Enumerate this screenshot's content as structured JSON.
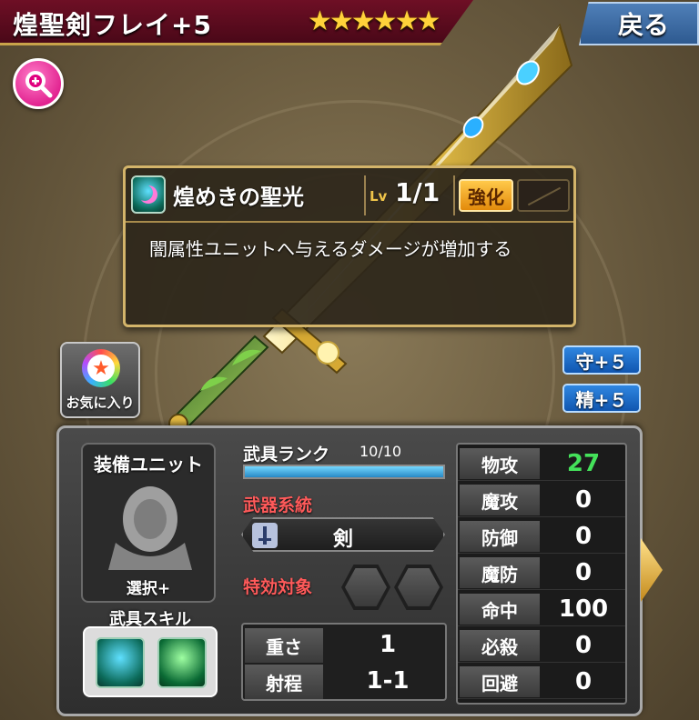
{
  "header": {
    "title": "煌聖剣フレイ+5",
    "stars": "★★★★★★",
    "back_label": "戻る"
  },
  "skill_popup": {
    "name": "煌めきの聖光",
    "lv_label": "Lv",
    "lv_value": "1/1",
    "enhance_label": "強化",
    "description": "闇属性ユニットへ与えるダメージが増加する"
  },
  "favorite": {
    "label": "お気に入り"
  },
  "buffs": [
    {
      "label": "守+５"
    },
    {
      "label": "精+５"
    }
  ],
  "panel": {
    "unit_title": "装備ユニット",
    "unit_select": "選択+",
    "skill_label": "武具スキル",
    "rank_label": "武具ランク",
    "rank_value": "10/10",
    "rank_fraction": 1.0,
    "weapon_type_label": "武器系統",
    "weapon_type_value": "剣",
    "effective_label": "特効対象",
    "weight_label": "重さ",
    "weight_value": "1",
    "range_label": "射程",
    "range_value": "1-1",
    "stats": [
      {
        "label": "物攻",
        "value": "27"
      },
      {
        "label": "魔攻",
        "value": "0"
      },
      {
        "label": "防御",
        "value": "0"
      },
      {
        "label": "魔防",
        "value": "0"
      },
      {
        "label": "命中",
        "value": "100"
      },
      {
        "label": "必殺",
        "value": "0"
      },
      {
        "label": "回避",
        "value": "0"
      }
    ]
  },
  "colors": {
    "title_bg": "#5a0a1e",
    "star": "#ffd23a",
    "back_button": "#3b6ea5",
    "enhance": "#f5a623",
    "buff": "#1f6fd1",
    "highlight_stat": "#44e15a",
    "label_red": "#ff5a5a"
  },
  "icons": {
    "zoom": "zoom-in-icon",
    "skill": "holy-light-icon",
    "favorite": "rainbow-star-icon",
    "weapon_type": "sword-icon",
    "unit": "unit-silhouette-icon",
    "next": "next-arrow-icon"
  }
}
